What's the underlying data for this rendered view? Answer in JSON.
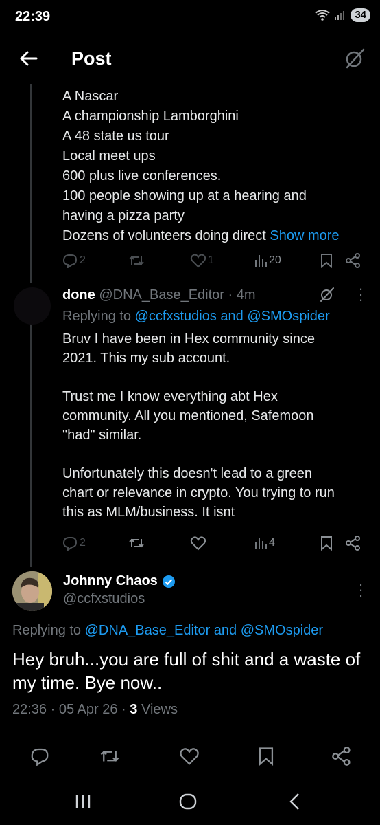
{
  "status": {
    "time": "22:39",
    "battery": "34"
  },
  "header": {
    "title": "Post"
  },
  "prev_post": {
    "lines": [
      "A Nascar",
      "A championship Lamborghini",
      "A 48 state us tour",
      "Local meet ups",
      "600 plus live conferences.",
      "100 people showing up at a hearing and",
      "having a pizza party",
      "Dozens of volunteers doing direct"
    ],
    "show_more": "Show more",
    "stats": {
      "replies": "2",
      "likes": "1",
      "views": "20"
    }
  },
  "reply": {
    "name": "done",
    "handle": "@DNA_Base_Editor",
    "sep": "·",
    "time": "4m",
    "replying_prefix": "Replying to",
    "replying_to": "@ccfxstudios and @SMOspider",
    "body": "Bruv I have been in Hex community since\n2021. This my sub account.\n\nTrust me I know everything abt Hex\ncommunity. All you mentioned,  Safemoon\n\"had\" similar.\n\nUnfortunately this doesn't lead to a green\nchart or relevance in crypto. You trying to run\nthis as MLM/business. It isnt",
    "stats": {
      "replies": "2",
      "views": "4"
    }
  },
  "main": {
    "name": "Johnny Chaos",
    "handle": "@ccfxstudios",
    "replying_prefix": "Replying to",
    "replying_to": "@DNA_Base_Editor and @SMOspider",
    "text": "Hey bruh...you are full of shit and a waste of my time. Bye now..",
    "time": "22:36",
    "sep1": "·",
    "date": "05 Apr 26",
    "sep2": "·",
    "views_count": "3",
    "views_label": "Views"
  },
  "colors": {
    "accent": "#1d9bf0",
    "muted": "#71767b",
    "text": "#e7e9ea",
    "background": "#000000"
  },
  "icons": [
    "back-arrow-icon",
    "grok-icon",
    "reply-icon",
    "retweet-icon",
    "like-icon",
    "views-icon",
    "bookmark-icon",
    "share-icon",
    "more-icon",
    "verified-badge-icon",
    "wifi-icon",
    "signal-icon"
  ]
}
